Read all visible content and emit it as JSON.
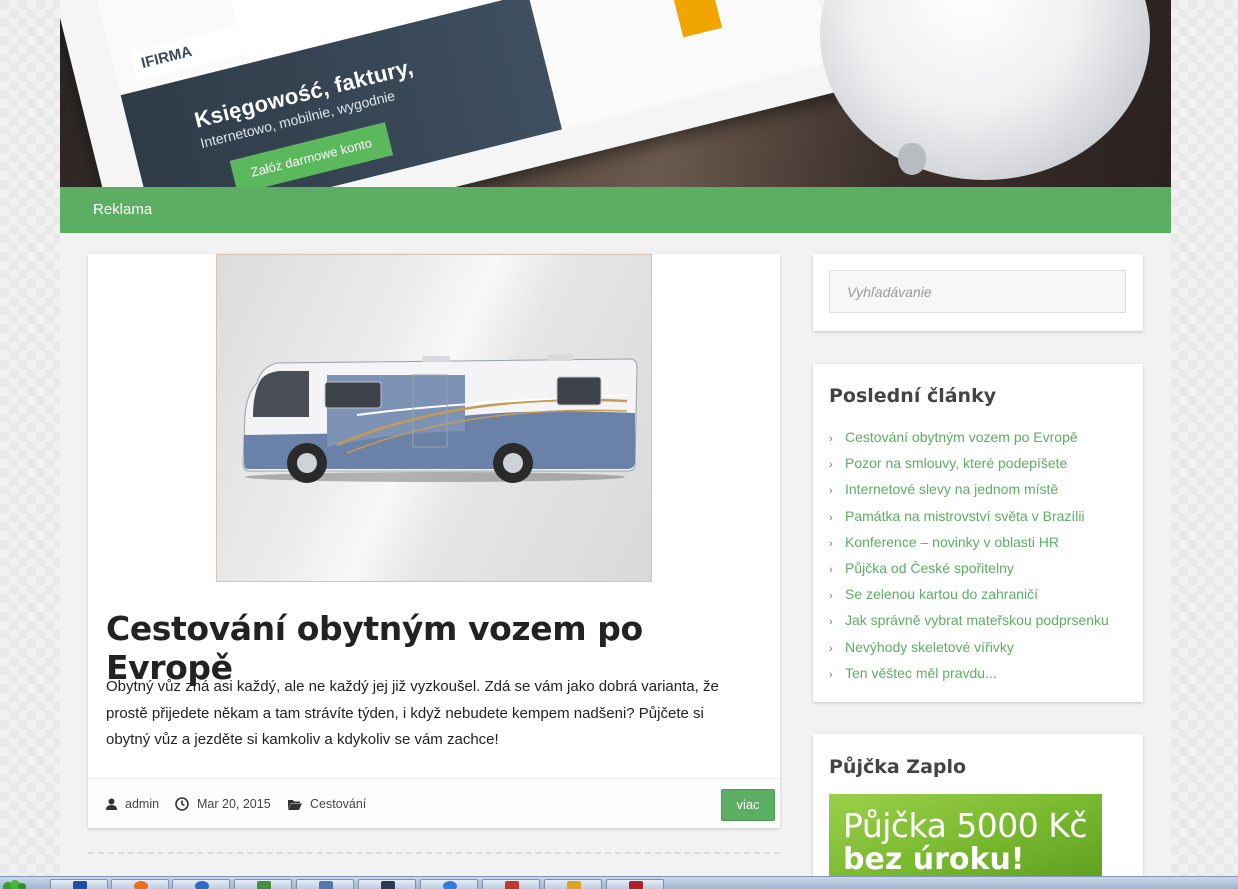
{
  "banner": {
    "logo_text": "IFIRMA",
    "headline": "Księgowość, faktury,",
    "subline": "Internetowo, mobilnie, wygodnie",
    "cta_label": "Załóż darmowe konto"
  },
  "nav": {
    "items": [
      {
        "label": "Reklama"
      }
    ]
  },
  "post": {
    "title": "Cestování obytným vozem po Evropě",
    "excerpt": "Obytný vůz zná asi každý, ale ne každý jej již vyzkoušel. Zdá se vám jako dobrá varianta, že prostě přijedete někam a tam strávíte týden, i když nebudete kempem nadšeni? Půjčete si obytný vůz a jezděte si kamkoliv a kdykoliv se vám zachce!",
    "author": "admin",
    "date": "Mar 20, 2015",
    "category": "Cestování",
    "more_label": "viac"
  },
  "sidebar": {
    "search": {
      "placeholder": "Vyhľadávanie",
      "value": ""
    },
    "recent": {
      "title": "Poslední články",
      "items": [
        "Cestování obytným vozem po Evropě",
        "Pozor na smlouvy, které podepíšete",
        "Internetové slevy na jednom místě",
        "Památka na mistrovství světa v Brazílii",
        "Konference – novinky v oblasti HR",
        "Půjčka od České spořitelny",
        "Se zelenou kartou do zahraničí",
        "Jak správně vybrat mateřskou podprsenku",
        "Nevýhody skeletové vířivky",
        "Ten věštec měl pravdu..."
      ]
    },
    "ad": {
      "title": "Půjčka Zaplo",
      "line1": "Půjčka 5000 Kč",
      "line2": "bez úroku!"
    }
  },
  "colors": {
    "accent": "#5cae63",
    "link": "#5cae63",
    "title_text": "#222222"
  },
  "taskbar": {
    "icons": [
      "start-orb-icon",
      "network-icon",
      "firefox-icon",
      "browser-icon",
      "spreadsheet-icon",
      "window-icon",
      "monitor-icon",
      "internet-explorer-icon",
      "paint-icon",
      "pencil-icon",
      "pdf-icon"
    ]
  }
}
